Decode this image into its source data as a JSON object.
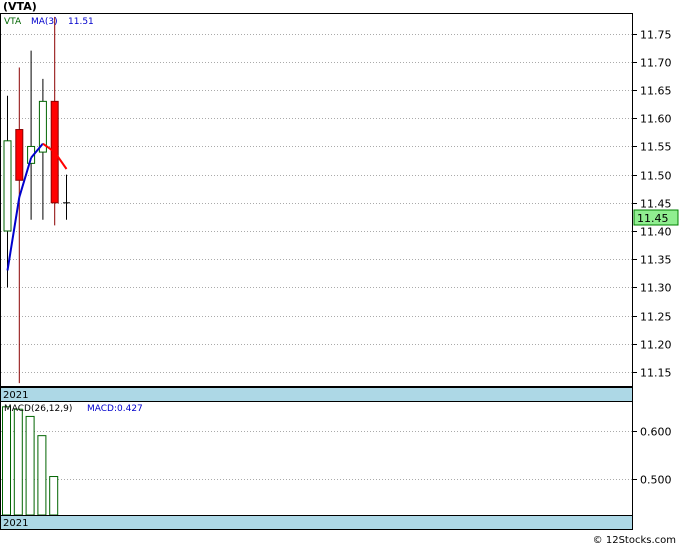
{
  "header": {
    "symbol": "(VTA)"
  },
  "price_panel": {
    "legend_symbol": "VTA",
    "legend_ma_label": "MA(3)",
    "legend_ma_value": "11.51",
    "year_label": "2021",
    "last_price_tag": "11.45"
  },
  "macd_panel": {
    "label": "MACD(26,12,9)",
    "value_label": "MACD:0.427",
    "year_label": "2021"
  },
  "footer": {
    "credit": "© 12Stocks.com"
  },
  "colors": {
    "up": "#006400",
    "down": "#ff0000",
    "ma_rise": "#0000cc",
    "ma_fall": "#ff0000",
    "macd_bar": "#006400",
    "year_band": "#add8e6",
    "price_tag_bg": "#90ee90"
  },
  "chart_data": [
    {
      "type": "candlestick",
      "y_ticks": [
        "11.15",
        "11.20",
        "11.25",
        "11.30",
        "11.35",
        "11.40",
        "11.45",
        "11.50",
        "11.55",
        "11.60",
        "11.65",
        "11.70",
        "11.75"
      ],
      "ylim": [
        11.125,
        11.785
      ],
      "candles": [
        {
          "open": 11.4,
          "high": 11.64,
          "low": 11.3,
          "close": 11.56
        },
        {
          "open": 11.58,
          "high": 11.69,
          "low": 11.13,
          "close": 11.49
        },
        {
          "open": 11.52,
          "high": 11.72,
          "low": 11.42,
          "close": 11.55
        },
        {
          "open": 11.54,
          "high": 11.67,
          "low": 11.42,
          "close": 11.63
        },
        {
          "open": 11.63,
          "high": 11.78,
          "low": 11.41,
          "close": 11.45
        },
        {
          "open": 11.45,
          "high": 11.5,
          "low": 11.42,
          "close": 11.45
        }
      ],
      "ma3": [
        11.33,
        11.46,
        11.53,
        11.555,
        11.54,
        11.51
      ],
      "last_price": 11.45
    },
    {
      "type": "bar",
      "name": "MACD",
      "y_ticks": [
        "0.500",
        "0.600"
      ],
      "ylim": [
        0.425,
        0.66
      ],
      "values": [
        0.65,
        0.645,
        0.63,
        0.59,
        0.505
      ]
    }
  ]
}
